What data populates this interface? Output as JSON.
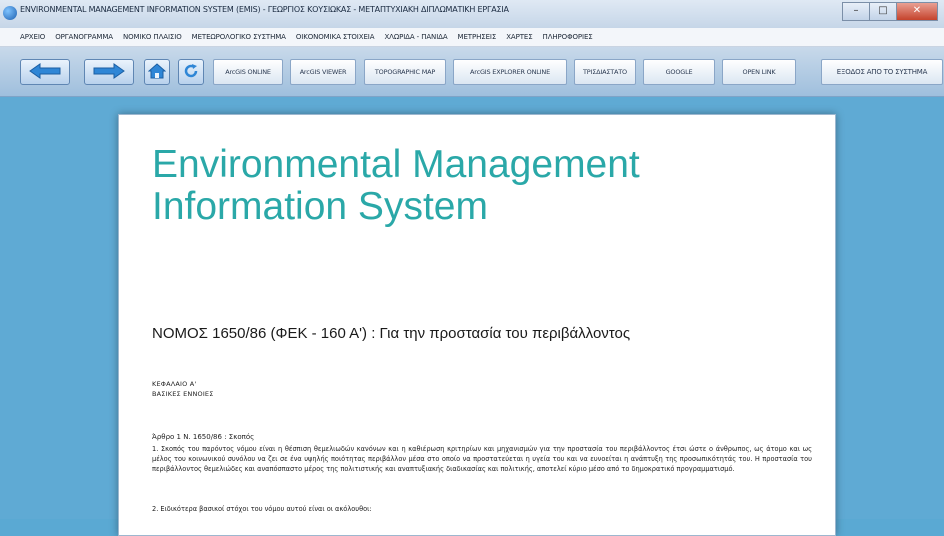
{
  "window": {
    "title": "ENVIRONMENTAL MANAGEMENT INFORMATION SYSTEM (EMIS) - ΓΕΩΡΓΙΟΣ ΚΟΥΣΙΩΚΑΣ - ΜΕΤΑΠΤΥΧΙΑΚΗ ΔΙΠΛΩΜΑΤΙΚΗ ΕΡΓΑΣΙΑ",
    "buttons": {
      "minimize": "–",
      "maximize": "□",
      "close": "✕"
    }
  },
  "menu": [
    "ΑΡΧΕΙΟ",
    "ΟΡΓΑΝΟΓΡΑΜΜΑ",
    "ΝΟΜΙΚΟ ΠΛΑΙΣΙΟ",
    "ΜΕΤΕΩΡΟΛΟΓΙΚΟ ΣΥΣΤΗΜΑ",
    "ΟΙΚΟΝΟΜΙΚΑ ΣΤΟΙΧΕΙΑ",
    "ΧΛΩΡΙΔΑ - ΠΑΝΙΔΑ",
    "ΜΕΤΡΗΣΕΙΣ",
    "ΧΑΡΤΕΣ",
    "ΠΛΗΡΟΦΟΡΙΕΣ"
  ],
  "toolbar": {
    "nav_icons": [
      "back-arrow-icon",
      "forward-arrow-icon",
      "home-icon",
      "refresh-icon"
    ],
    "buttons": [
      "ArcGIS ONLINE",
      "ArcGIS VIEWER",
      "TOPOGRAPHIC MAP",
      "ArcGIS EXPLORER ONLINE",
      "ΤΡΙΣΔΙΑΣΤΑΤΟ",
      "GOOGLE",
      "OPEN LINK"
    ],
    "exit_button": "ΕΞΟΔΟΣ ΑΠΟ ΤΟ ΣΥΣΤΗΜΑ"
  },
  "document": {
    "title_line1": "Environmental Management",
    "title_line2": "Information System",
    "law_heading": "ΝΟΜΟΣ 1650/86 (ΦΕΚ - 160 Α') : Για την προστασία του περιβάλλοντος",
    "chapter": "ΚΕΦΑΛΑΙΟ Α'",
    "chapter_subtitle": "ΒΑΣΙΚΕΣ ΕΝΝΟΙΕΣ",
    "article": "Άρθρο 1 Ν. 1650/86 : Σκοπός",
    "paragraph": "1. Σκοπός του παρόντος νόμου είναι η θέσπιση θεμελιωδών κανόνων και η καθιέρωση κριτηρίων και μηχανισμών για την προστασία του περιβάλλοντος έτσι ώστε ο άνθρωπος, ως άτομο και ως μέλος του κοινωνικού συνόλου να ζει σε ένα υψηλής ποιότητας περιβάλλον μέσα στο οποίο να προστατεύεται η υγεία του και να ευνοείται η ανάπτυξη της προσωπικότητάς του. Η προστασία του περιβάλλοντος θεμελιώδες και αναπόσπαστο μέρος της πολιτιστικής και αναπτυξιακής διαδικασίας και πολιτικής, αποτελεί κύριο μέσο από το δημοκρατικό προγραμματισμό.",
    "item2": "2. Ειδικότερα βασικοί στόχοι του νόμου αυτού είναι οι ακόλουθοι:"
  },
  "colors": {
    "background": "#5faad4",
    "title_teal": "#2aa8a8"
  }
}
